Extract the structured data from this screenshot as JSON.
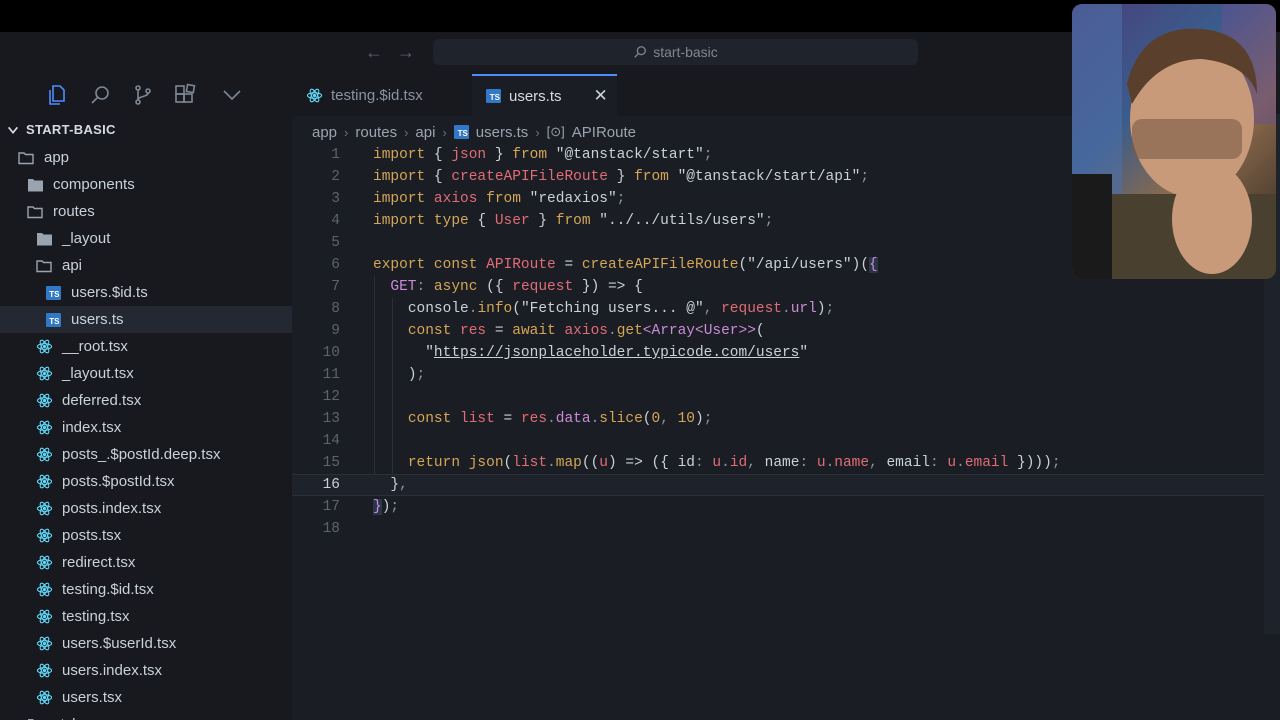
{
  "titlebar": {
    "search_text": "start-basic",
    "back_icon": "arrow-left-icon",
    "forward_icon": "arrow-right-icon"
  },
  "activity": {
    "icons": [
      "files-icon",
      "search-icon",
      "source-control-icon",
      "extensions-icon",
      "chevron-down-icon"
    ]
  },
  "explorer": {
    "title": "START-BASIC",
    "items": [
      {
        "label": "app",
        "kind": "folder"
      },
      {
        "label": "components",
        "kind": "folder"
      },
      {
        "label": "routes",
        "kind": "folder"
      },
      {
        "label": "_layout",
        "kind": "folder"
      },
      {
        "label": "api",
        "kind": "folder"
      },
      {
        "label": "users.$id.ts",
        "kind": "ts"
      },
      {
        "label": "users.ts",
        "kind": "ts",
        "selected": true
      },
      {
        "label": "__root.tsx",
        "kind": "react"
      },
      {
        "label": "_layout.tsx",
        "kind": "react"
      },
      {
        "label": "deferred.tsx",
        "kind": "react"
      },
      {
        "label": "index.tsx",
        "kind": "react"
      },
      {
        "label": "posts_.$postId.deep.tsx",
        "kind": "react"
      },
      {
        "label": "posts.$postId.tsx",
        "kind": "react"
      },
      {
        "label": "posts.index.tsx",
        "kind": "react"
      },
      {
        "label": "posts.tsx",
        "kind": "react"
      },
      {
        "label": "redirect.tsx",
        "kind": "react"
      },
      {
        "label": "testing.$id.tsx",
        "kind": "react"
      },
      {
        "label": "testing.tsx",
        "kind": "react"
      },
      {
        "label": "users.$userId.tsx",
        "kind": "react"
      },
      {
        "label": "users.index.tsx",
        "kind": "react"
      },
      {
        "label": "users.tsx",
        "kind": "react"
      },
      {
        "label": "styles",
        "kind": "folder"
      }
    ]
  },
  "tabs": [
    {
      "label": "testing.$id.tsx",
      "icon": "react-icon"
    },
    {
      "label": "users.ts",
      "icon": "ts-icon",
      "active": true
    }
  ],
  "breadcrumb": [
    "app",
    "routes",
    "api",
    "users.ts",
    "APIRoute"
  ],
  "code": {
    "current_line": 16,
    "line_numbers": [
      "1",
      "2",
      "3",
      "4",
      "5",
      "6",
      "7",
      "8",
      "9",
      "10",
      "11",
      "12",
      "13",
      "14",
      "15",
      "16",
      "17",
      "18"
    ]
  },
  "colors": {
    "accent": "#4f8cff",
    "ts_badge": "#3178c6",
    "react": "#61dafb"
  }
}
